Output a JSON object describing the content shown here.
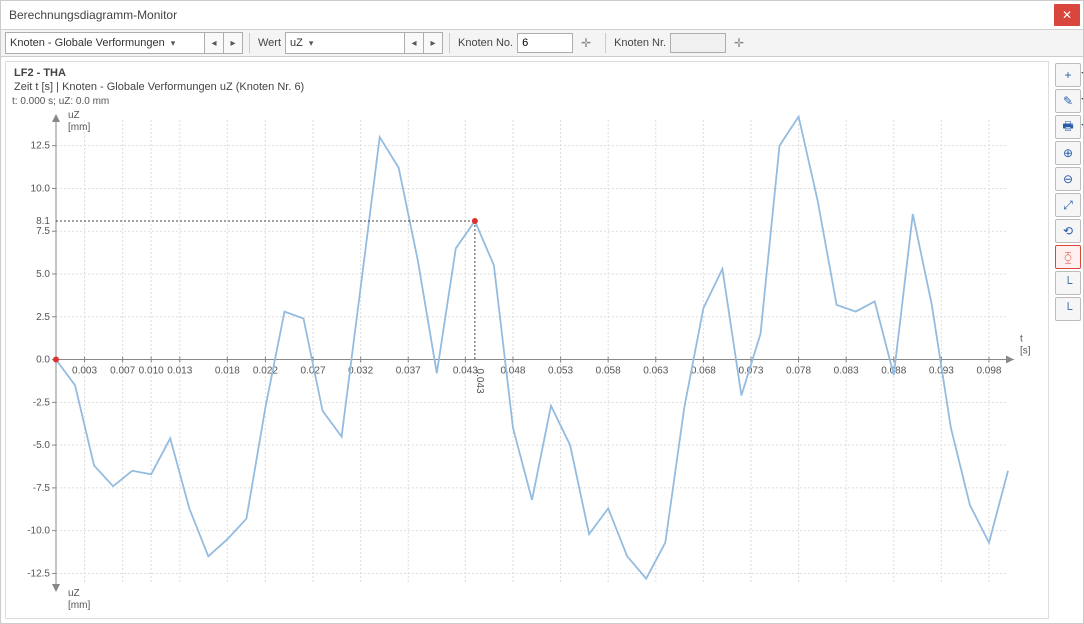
{
  "window": {
    "title": "Berechnungsdiagramm-Monitor"
  },
  "toolbar": {
    "dropdown1": "Knoten - Globale Verformungen",
    "label_wert": "Wert",
    "dropdown2": "uZ",
    "label_node_no": "Knoten No.",
    "node_no_value": "6",
    "label_node_nr": "Knoten Nr."
  },
  "chart": {
    "title1": "LF2 - THA",
    "title2": "Zeit t [s] | Knoten - Globale Verformungen uZ (Knoten Nr. 6)",
    "cursor_info": "t: 0.000 s; uZ: 0.0 mm",
    "y_axis_label_top": "uZ",
    "y_axis_unit_top": "[mm]",
    "y_axis_label_bot": "uZ",
    "y_axis_unit_bot": "[mm]",
    "x_axis_label": "t",
    "x_axis_unit": "[s]",
    "marker_y_label": "8.1",
    "marker_x_label": "0.043"
  },
  "sidetools": [
    {
      "name": "tool-axes-plus",
      "label": "+"
    },
    {
      "name": "tool-axes-edit",
      "label": "✎"
    },
    {
      "name": "tool-print",
      "label": "🖶"
    },
    {
      "name": "tool-zoom-in",
      "label": "⊕"
    },
    {
      "name": "tool-zoom-out",
      "label": "⊖"
    },
    {
      "name": "tool-zoom-fit",
      "label": "⤢"
    },
    {
      "name": "tool-zoom-reset",
      "label": "⟲"
    },
    {
      "name": "tool-magnet",
      "label": "⧲",
      "active": true
    },
    {
      "name": "tool-axes-l",
      "label": "└"
    },
    {
      "name": "tool-axes-l2",
      "label": "└"
    }
  ],
  "chart_data": {
    "type": "line",
    "title": "LF2 - THA — Zeit t [s] | Knoten - Globale Verformungen uZ (Knoten Nr. 6)",
    "xlabel": "t [s]",
    "ylabel": "uZ [mm]",
    "xlim": [
      0,
      0.1
    ],
    "ylim": [
      -13,
      14
    ],
    "y_ticks": [
      -12.5,
      -10.0,
      -7.5,
      -5.0,
      -2.5,
      0,
      2.5,
      5.0,
      7.5,
      10.0,
      12.5
    ],
    "x_ticks": [
      0.003,
      0.007,
      0.01,
      0.013,
      0.018,
      0.022,
      0.027,
      0.032,
      0.037,
      0.043,
      0.048,
      0.053,
      0.058,
      0.063,
      0.068,
      0.073,
      0.078,
      0.083,
      0.088,
      0.093,
      0.098
    ],
    "x": [
      0.0,
      0.002,
      0.004,
      0.006,
      0.008,
      0.01,
      0.012,
      0.014,
      0.016,
      0.018,
      0.02,
      0.022,
      0.024,
      0.026,
      0.028,
      0.03,
      0.032,
      0.034,
      0.036,
      0.038,
      0.04,
      0.042,
      0.044,
      0.046,
      0.048,
      0.05,
      0.052,
      0.054,
      0.056,
      0.058,
      0.06,
      0.062,
      0.064,
      0.066,
      0.068,
      0.07,
      0.072,
      0.074,
      0.076,
      0.078,
      0.08,
      0.082,
      0.084,
      0.086,
      0.088,
      0.09,
      0.092,
      0.094,
      0.096,
      0.098,
      0.1
    ],
    "series": [
      {
        "name": "uZ (Knoten Nr. 6)",
        "values": [
          0.0,
          -1.5,
          -6.2,
          -7.4,
          -6.5,
          -6.7,
          -4.6,
          -8.7,
          -11.5,
          -10.5,
          -9.3,
          -2.8,
          2.8,
          2.4,
          -3.0,
          -4.5,
          4.2,
          13.0,
          11.2,
          5.8,
          -0.8,
          6.5,
          8.1,
          5.5,
          -4.0,
          -8.2,
          -2.7,
          -5.0,
          -10.2,
          -8.7,
          -11.5,
          -12.8,
          -10.7,
          -2.8,
          3.0,
          5.3,
          -2.1,
          1.5,
          12.5,
          14.2,
          9.3,
          3.2,
          2.8,
          3.4,
          -0.9,
          8.5,
          3.2,
          -4.0,
          -8.5,
          -10.7,
          -6.5
        ]
      }
    ],
    "markers": [
      {
        "x": 0.0,
        "y": 0.0
      },
      {
        "x": 0.044,
        "y": 8.1
      }
    ],
    "annotations": [
      {
        "type": "y-guide",
        "y": 8.1,
        "label": "8.1"
      },
      {
        "type": "x-guide",
        "x": 0.044,
        "label": "0.043"
      }
    ]
  }
}
